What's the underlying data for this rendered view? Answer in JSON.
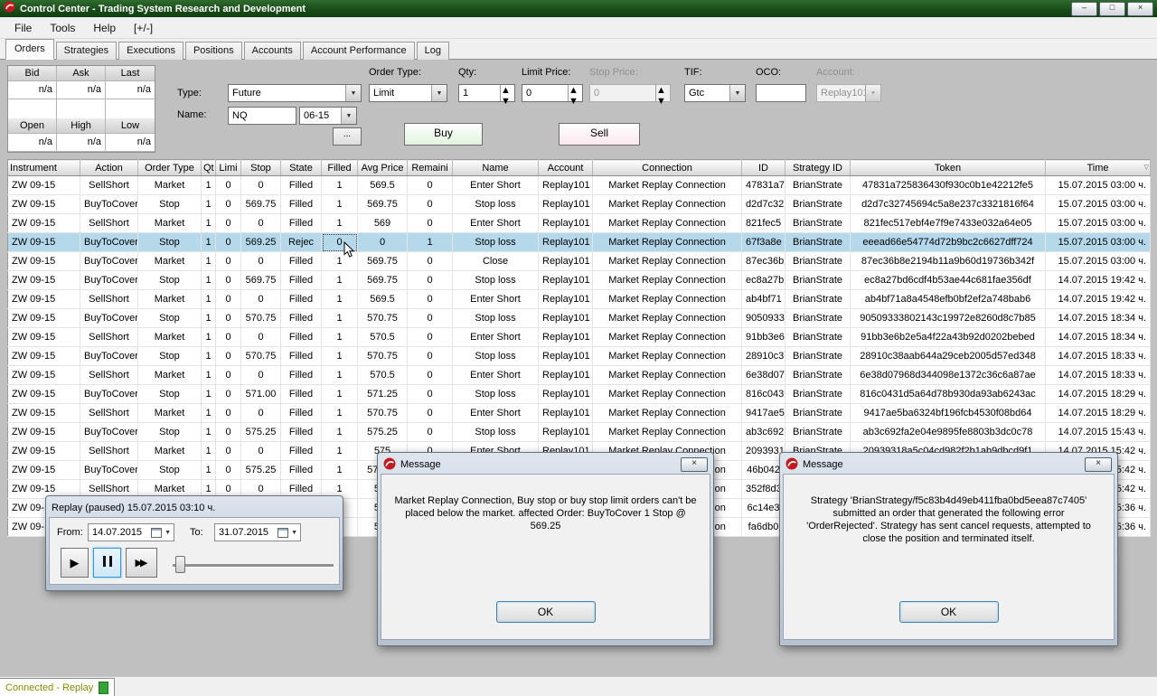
{
  "window": {
    "title": "Control Center - Trading System Research and Development",
    "menu_items": [
      "File",
      "Tools",
      "Help",
      "[+/-]"
    ],
    "tabs": [
      "Orders",
      "Strategies",
      "Executions",
      "Positions",
      "Accounts",
      "Account Performance",
      "Log"
    ],
    "active_tab_index": 0
  },
  "icons": {
    "minimize": "–",
    "restore": "□",
    "close": "×",
    "dropdown": "▼",
    "spin_up": "▲",
    "spin_down": "▼",
    "sort": "▽",
    "play": "▶",
    "fast_forward": "▶▶"
  },
  "order_panel": {
    "quote": {
      "headers_top": [
        "Bid",
        "Ask",
        "Last"
      ],
      "values_top": [
        "n/a",
        "n/a",
        "n/a"
      ],
      "headers_bottom": [
        "Open",
        "High",
        "Low"
      ],
      "values_bottom": [
        "n/a",
        "n/a",
        "n/a"
      ]
    },
    "type_label": "Type:",
    "type_value": "Future",
    "name_label": "Name:",
    "name_value": "NQ",
    "expiry_value": "06-15",
    "browse_label": "...",
    "buy_label": "Buy",
    "sell_label": "Sell",
    "order_type_label": "Order Type:",
    "order_type_value": "Limit",
    "qty_label": "Qty:",
    "qty_value": "1",
    "limit_price_label": "Limit Price:",
    "limit_price_value": "0",
    "stop_price_label": "Stop Price:",
    "stop_price_value": "0",
    "tif_label": "TIF:",
    "tif_value": "Gtc",
    "oco_label": "OCO:",
    "oco_value": "",
    "account_label": "Account:",
    "account_value": "Replay101"
  },
  "orders_table": {
    "columns": [
      "Instrument",
      "Action",
      "Order Type",
      "Qt",
      "Limi",
      "Stop",
      "State",
      "Filled",
      "Avg Price",
      "Remaini",
      "Name",
      "Account",
      "Connection",
      "ID",
      "Strategy ID",
      "Token",
      "Time"
    ],
    "selected_row": 3,
    "focus_cell": {
      "row": 3,
      "col": 7
    },
    "rows": [
      [
        "ZW 09-15",
        "SellShort",
        "Market",
        "1",
        "0",
        "0",
        "Filled",
        "1",
        "569.5",
        "0",
        "Enter Short",
        "Replay101",
        "Market Replay Connection",
        "47831a7",
        "BrianStrate",
        "47831a725836430f930c0b1e42212fe5",
        "15.07.2015 03:00 ч."
      ],
      [
        "ZW 09-15",
        "BuyToCover",
        "Stop",
        "1",
        "0",
        "569.75",
        "Filled",
        "1",
        "569.75",
        "0",
        "Stop loss",
        "Replay101",
        "Market Replay Connection",
        "d2d7c32",
        "BrianStrate",
        "d2d7c32745694c5a8e237c3321816f64",
        "15.07.2015 03:00 ч."
      ],
      [
        "ZW 09-15",
        "SellShort",
        "Market",
        "1",
        "0",
        "0",
        "Filled",
        "1",
        "569",
        "0",
        "Enter Short",
        "Replay101",
        "Market Replay Connection",
        "821fec5",
        "BrianStrate",
        "821fec517ebf4e7f9e7433e032a64e05",
        "15.07.2015 03:00 ч."
      ],
      [
        "ZW 09-15",
        "BuyToCover",
        "Stop",
        "1",
        "0",
        "569.25",
        "Rejec",
        "0",
        "0",
        "1",
        "Stop loss",
        "Replay101",
        "Market Replay Connection",
        "67f3a8e",
        "BrianStrate",
        "eeead66e54774d72b9bc2c6627dff724",
        "15.07.2015 03:00 ч."
      ],
      [
        "ZW 09-15",
        "BuyToCover",
        "Market",
        "1",
        "0",
        "0",
        "Filled",
        "1",
        "569.75",
        "0",
        "Close",
        "Replay101",
        "Market Replay Connection",
        "87ec36b",
        "BrianStrate",
        "87ec36b8e2194b11a9b60d19736b342f",
        "15.07.2015 03:00 ч."
      ],
      [
        "ZW 09-15",
        "BuyToCover",
        "Stop",
        "1",
        "0",
        "569.75",
        "Filled",
        "1",
        "569.75",
        "0",
        "Stop loss",
        "Replay101",
        "Market Replay Connection",
        "ec8a27b",
        "BrianStrate",
        "ec8a27bd6cdf4b53ae44c681fae356df",
        "14.07.2015 19:42 ч."
      ],
      [
        "ZW 09-15",
        "SellShort",
        "Market",
        "1",
        "0",
        "0",
        "Filled",
        "1",
        "569.5",
        "0",
        "Enter Short",
        "Replay101",
        "Market Replay Connection",
        "ab4bf71",
        "BrianStrate",
        "ab4bf71a8a4548efb0bf2ef2a748bab6",
        "14.07.2015 19:42 ч."
      ],
      [
        "ZW 09-15",
        "BuyToCover",
        "Stop",
        "1",
        "0",
        "570.75",
        "Filled",
        "1",
        "570.75",
        "0",
        "Stop loss",
        "Replay101",
        "Market Replay Connection",
        "9050933",
        "BrianStrate",
        "90509333802143c19972e8260d8c7b85",
        "14.07.2015 18:34 ч."
      ],
      [
        "ZW 09-15",
        "SellShort",
        "Market",
        "1",
        "0",
        "0",
        "Filled",
        "1",
        "570.5",
        "0",
        "Enter Short",
        "Replay101",
        "Market Replay Connection",
        "91bb3e6",
        "BrianStrate",
        "91bb3e6b2e5a4f22a43b92d0202bebed",
        "14.07.2015 18:34 ч."
      ],
      [
        "ZW 09-15",
        "BuyToCover",
        "Stop",
        "1",
        "0",
        "570.75",
        "Filled",
        "1",
        "570.75",
        "0",
        "Stop loss",
        "Replay101",
        "Market Replay Connection",
        "28910c3",
        "BrianStrate",
        "28910c38aab644a29ceb2005d57ed348",
        "14.07.2015 18:33 ч."
      ],
      [
        "ZW 09-15",
        "SellShort",
        "Market",
        "1",
        "0",
        "0",
        "Filled",
        "1",
        "570.5",
        "0",
        "Enter Short",
        "Replay101",
        "Market Replay Connection",
        "6e38d07",
        "BrianStrate",
        "6e38d07968d344098e1372c36c6a87ae",
        "14.07.2015 18:33 ч."
      ],
      [
        "ZW 09-15",
        "BuyToCover",
        "Stop",
        "1",
        "0",
        "571.00",
        "Filled",
        "1",
        "571.25",
        "0",
        "Stop loss",
        "Replay101",
        "Market Replay Connection",
        "816c043",
        "BrianStrate",
        "816c0431d5a64d78b930da93ab6243ac",
        "14.07.2015 18:29 ч."
      ],
      [
        "ZW 09-15",
        "SellShort",
        "Market",
        "1",
        "0",
        "0",
        "Filled",
        "1",
        "570.75",
        "0",
        "Enter Short",
        "Replay101",
        "Market Replay Connection",
        "9417ae5",
        "BrianStrate",
        "9417ae5ba6324bf196fcb4530f08bd64",
        "14.07.2015 18:29 ч."
      ],
      [
        "ZW 09-15",
        "BuyToCover",
        "Stop",
        "1",
        "0",
        "575.25",
        "Filled",
        "1",
        "575.25",
        "0",
        "Stop loss",
        "Replay101",
        "Market Replay Connection",
        "ab3c692",
        "BrianStrate",
        "ab3c692fa2e04e9895fe8803b3dc0c78",
        "14.07.2015 15:43 ч."
      ],
      [
        "ZW 09-15",
        "SellShort",
        "Market",
        "1",
        "0",
        "0",
        "Filled",
        "1",
        "575",
        "0",
        "Enter Short",
        "Replay101",
        "Market Replay Connection",
        "2093931",
        "BrianStrate",
        "20939318a5c04cd982f2b1ab9dbcd9f1",
        "14.07.2015 15:42 ч."
      ],
      [
        "ZW 09-15",
        "BuyToCover",
        "Stop",
        "1",
        "0",
        "575.25",
        "Filled",
        "1",
        "575.25",
        "",
        "",
        "",
        "Market Replay Connection",
        "46b042",
        "",
        "",
        "14.07.2015 15:42 ч."
      ],
      [
        "ZW 09-15",
        "SellShort",
        "Market",
        "1",
        "0",
        "0",
        "Filled",
        "1",
        "575",
        "",
        "",
        "",
        "Market Replay Connection",
        "352f8d3",
        "",
        "",
        "14.07.2015 15:42 ч."
      ],
      [
        "ZW 09-15",
        "",
        "",
        "",
        "",
        "",
        "",
        "",
        "575",
        "",
        "",
        "",
        "Market Replay Connection",
        "6c14e3",
        "",
        "",
        "14.07.2015 15:36 ч."
      ],
      [
        "ZW 09-15",
        "",
        "",
        "",
        "",
        "",
        "",
        "",
        "575",
        "",
        "",
        "",
        "Market Replay Connection",
        "fa6db0",
        "",
        "",
        "14.07.2015 15:36 ч."
      ]
    ]
  },
  "replay_dialog": {
    "title": "Replay (paused) 15.07.2015 03:10 ч.",
    "from_label": "From:",
    "from_value": "14.07.2015",
    "to_label": "To:",
    "to_value": "31.07.2015"
  },
  "message_dialogs": [
    {
      "title": "Message",
      "text": "Market Replay Connection, Buy stop or buy stop limit orders can't be placed below the market. affected Order: BuyToCover 1 Stop @ 569.25",
      "ok_label": "OK"
    },
    {
      "title": "Message",
      "text": "Strategy 'BrianStrategy/f5c83b4d49eb411fba0bd5eea87c7405' submitted an order that generated the following error 'OrderRejected'. Strategy has sent cancel requests, attempted to close the position and terminated itself.",
      "ok_label": "OK"
    }
  ],
  "status_bar": {
    "label": "Connected - Replay"
  }
}
